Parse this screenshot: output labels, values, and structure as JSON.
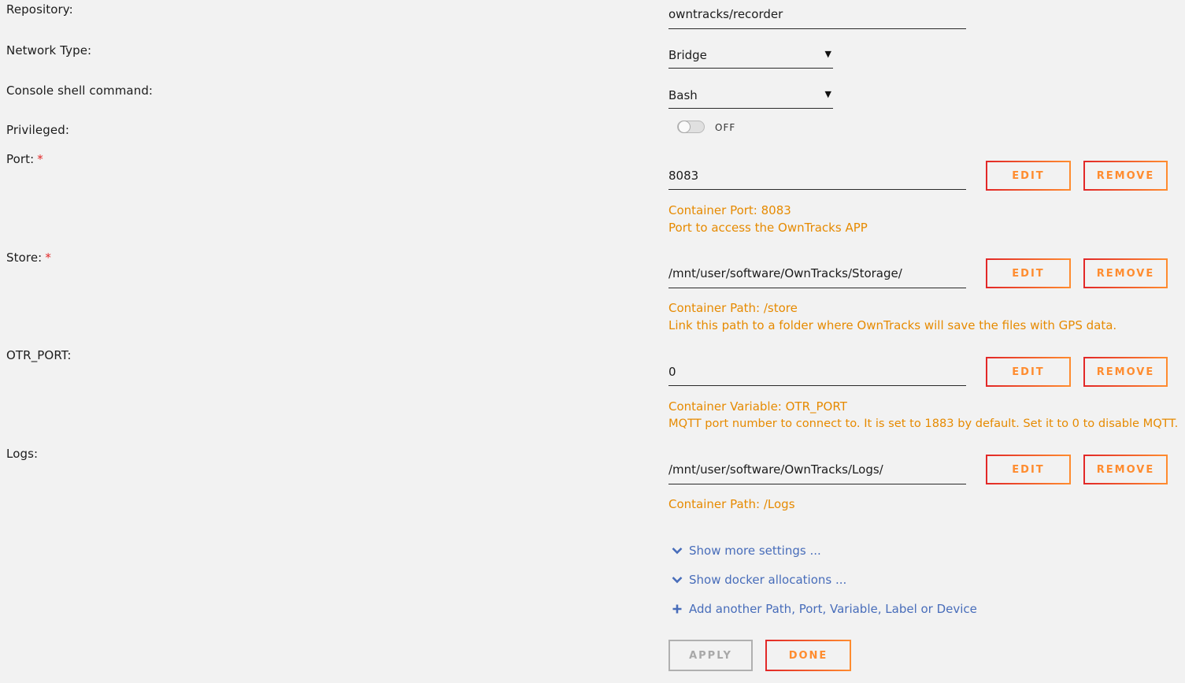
{
  "repository": {
    "label": "Repository:",
    "value": "owntracks/recorder"
  },
  "network_type": {
    "label": "Network Type:",
    "value": "Bridge"
  },
  "console_shell": {
    "label": "Console shell command:",
    "value": "Bash"
  },
  "privileged": {
    "label": "Privileged:",
    "state": "OFF"
  },
  "port": {
    "label": "Port:",
    "required": "*",
    "value": "8083",
    "help_line1": "Container Port: 8083",
    "help_line2": "Port to access the OwnTracks APP"
  },
  "store": {
    "label": "Store:",
    "required": "*",
    "value": "/mnt/user/software/OwnTracks/Storage/",
    "help_line1": "Container Path: /store",
    "help_line2": "Link this path to a folder where OwnTracks will save the files with GPS data."
  },
  "otr_port": {
    "label": "OTR_PORT:",
    "value": "0",
    "help_line1": "Container Variable: OTR_PORT",
    "help_line2": "MQTT port number to connect to. It is set to 1883 by default. Set it to 0 to disable MQTT."
  },
  "logs": {
    "label": "Logs:",
    "value": "/mnt/user/software/OwnTracks/Logs/",
    "help_line1": "Container Path: /Logs"
  },
  "buttons": {
    "edit": "EDIT",
    "remove": "REMOVE",
    "apply": "APPLY",
    "done": "DONE"
  },
  "links": {
    "show_more": "Show more settings ...",
    "show_docker": "Show docker allocations ...",
    "add_another": "Add another Path, Port, Variable, Label or Device"
  },
  "colors": {
    "accent": "#ff8c2f",
    "accent_red": "#e22828",
    "help_text": "#e68a00",
    "link": "#486dba"
  },
  "icons": {
    "caret": "caret-down-icon",
    "chevron": "chevron-down-icon",
    "plus": "plus-icon"
  }
}
